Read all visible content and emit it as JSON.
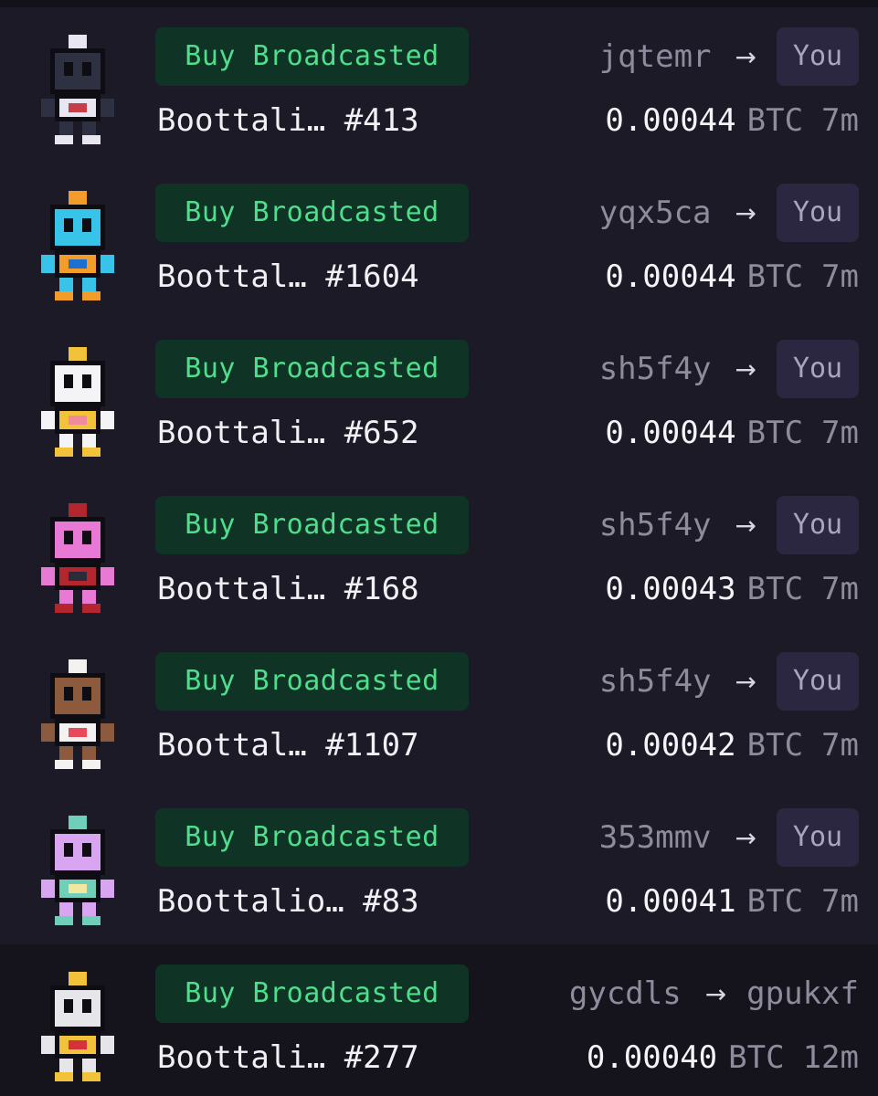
{
  "sales": [
    {
      "status": "Buy Broadcasted",
      "name": "Boottali… #413",
      "from": "jqtemr",
      "to": "You",
      "to_is_you": true,
      "price": "0.00044",
      "unit": "BTC",
      "time": "7m",
      "avatar": "bomb-robot-icon",
      "colors": {
        "body": "#2d3142",
        "accent": "#e8e6f0",
        "trim": "#c73e4b"
      }
    },
    {
      "status": "Buy Broadcasted",
      "name": "Boottal… #1604",
      "from": "yqx5ca",
      "to": "You",
      "to_is_you": true,
      "price": "0.00044",
      "unit": "BTC",
      "time": "7m",
      "avatar": "cyan-robot-icon",
      "colors": {
        "body": "#38c4e8",
        "accent": "#f39c2a",
        "trim": "#1d6fd1"
      }
    },
    {
      "status": "Buy Broadcasted",
      "name": "Boottali… #652",
      "from": "sh5f4y",
      "to": "You",
      "to_is_you": true,
      "price": "0.00044",
      "unit": "BTC",
      "time": "7m",
      "avatar": "white-hood-robot-icon",
      "colors": {
        "body": "#f4f4f6",
        "accent": "#f2c23a",
        "trim": "#f08a9c"
      }
    },
    {
      "status": "Buy Broadcasted",
      "name": "Boottali… #168",
      "from": "sh5f4y",
      "to": "You",
      "to_is_you": true,
      "price": "0.00043",
      "unit": "BTC",
      "time": "7m",
      "avatar": "witch-robot-icon",
      "colors": {
        "body": "#e87ad6",
        "accent": "#b3262e",
        "trim": "#2b2b3a"
      }
    },
    {
      "status": "Buy Broadcasted",
      "name": "Boottal… #1107",
      "from": "sh5f4y",
      "to": "You",
      "to_is_you": true,
      "price": "0.00042",
      "unit": "BTC",
      "time": "7m",
      "avatar": "brown-hair-robot-icon",
      "colors": {
        "body": "#8c5a3c",
        "accent": "#f4f2f0",
        "trim": "#e84a5a"
      }
    },
    {
      "status": "Buy Broadcasted",
      "name": "Boottalio… #83",
      "from": "353mmv",
      "to": "You",
      "to_is_you": true,
      "price": "0.00041",
      "unit": "BTC",
      "time": "7m",
      "avatar": "lilac-robot-icon",
      "colors": {
        "body": "#d8a6f0",
        "accent": "#6fcfb8",
        "trim": "#f2e6a0"
      }
    },
    {
      "status": "Buy Broadcasted",
      "name": "Boottali… #277",
      "from": "gycdls",
      "to": "gpukxf",
      "to_is_you": false,
      "price": "0.00040",
      "unit": "BTC",
      "time": "12m",
      "avatar": "sparkle-robot-icon",
      "colors": {
        "body": "#e6e6ea",
        "accent": "#f2c23a",
        "trim": "#d6303a"
      }
    }
  ]
}
